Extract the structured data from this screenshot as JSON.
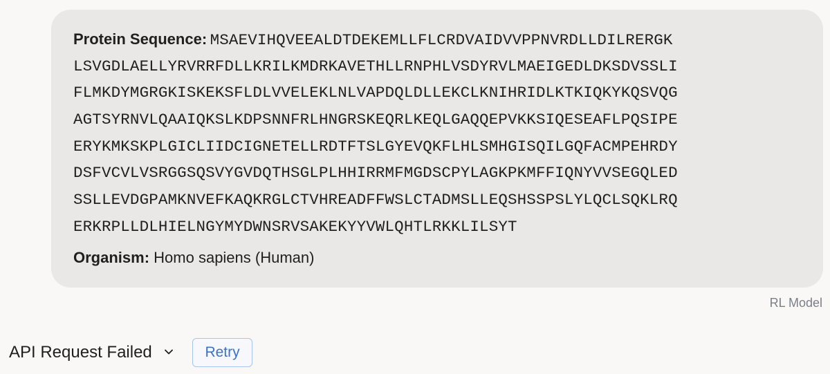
{
  "message": {
    "sequence_label": "Protein Sequence:",
    "sequence_lines": [
      "MSAEVIHQVEEALDTDEKEMLLFLCRDVAIDVVPPNVRDLLDILRERGK",
      "LSVGDLAELLYRVRRFDLLKRILKMDRKAVETHLLRNPHLVSDYRVLMAEIGEDLDKSDVSSLI",
      "FLMKDYMGRGKISKEKSFLDLVVELEKLNLVAPDQLDLLEKCLKNIHRIDLKTKIQKYKQSVQG",
      "AGTSYRNVLQAAIQKSLKDPSNNFRLHNGRSKEQRLKEQLGAQQEPVKKSIQESEAFLPQSIPE",
      "ERYKMKSKPLGICLIIDCIGNETELLRDTFTSLGYEVQKFLHLSMHGISQILGQFACMPEHRDY",
      "DSFVCVLVSRGGSQSVYGVDQTHSGLPLHHIRRMFMGDSCPYLAGKPKMFFIQNYVVSEGQLED",
      "SSLLEVDGPAMKNVEFKAQKRGLCTVHREADFFWSLCTADMSLLEQSHSSPSLYLQCLSQKLRQ",
      "ERKRPLLDLHIELNGYMYDWNSRVSAKEKYYVWLQHTLRKKLILSYT"
    ],
    "organism_label": "Organism:",
    "organism_value": "Homo sapiens (Human)"
  },
  "model_label": "RL Model",
  "status": {
    "text": "API Request Failed",
    "icon": "chevron-down-icon",
    "retry_label": "Retry"
  },
  "colors": {
    "background": "#faf8f6",
    "bubble": "#e9e8e7",
    "retry_text": "#3a73c8",
    "retry_border": "#a9c4ea",
    "muted": "#7a7f87"
  }
}
